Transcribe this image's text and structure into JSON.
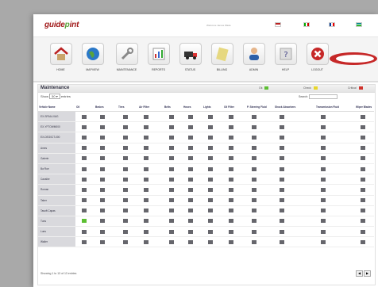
{
  "brand": {
    "logo_a": "guide",
    "logo_b": "p",
    "logo_c": "int"
  },
  "welcome_text": "Welcome James Wade",
  "nav": [
    {
      "label": "HOME",
      "icon": "house-icon"
    },
    {
      "label": "MAPVIEW",
      "icon": "globe-icon"
    },
    {
      "label": "MAINTENANCE",
      "icon": "wrench-icon"
    },
    {
      "label": "REPORTS",
      "icon": "report-chart-icon"
    },
    {
      "label": "STATUS",
      "icon": "truck-icon"
    },
    {
      "label": "BILLING",
      "icon": "billing-note-icon"
    },
    {
      "label": "ADMIN",
      "icon": "admin-person-icon"
    },
    {
      "label": "HELP",
      "icon": "help-icon"
    },
    {
      "label": "LOGOUT",
      "icon": "logout-x-icon"
    }
  ],
  "maintenance": {
    "title": "Maintenance",
    "legend_ok": "Ok",
    "legend_check": "Check",
    "legend_critical": "Critical",
    "colors": {
      "ok": "#5cbf32",
      "check": "#e8d62a",
      "critical": "#d0332d",
      "neutral": "#66666c"
    },
    "show_label": "Show",
    "show_value": "50",
    "entries_label": "entries",
    "search_label": "Search:",
    "columns": [
      "Vehicle Name",
      "Oil",
      "Brakes",
      "Tires",
      "Air Filter",
      "Belts",
      "Hoses",
      "Lights",
      "Oil Filter",
      "P. Steering Fluid",
      "Shock Absorbers",
      "Transmission Fluid",
      "Wiper Blades"
    ],
    "rows": [
      {
        "name": "EX-SF0A4-0AG",
        "oil": "neutral"
      },
      {
        "name": "EX-YFTOWM000",
        "oil": "neutral"
      },
      {
        "name": "EX-DEG0CT-000",
        "oil": "neutral"
      },
      {
        "name": "Ames",
        "oil": "neutral"
      },
      {
        "name": "Galerie",
        "oil": "neutral"
      },
      {
        "name": "Ba Rue",
        "oil": "neutral"
      },
      {
        "name": "Cavalier",
        "oil": "neutral"
      },
      {
        "name": "Roman",
        "oil": "neutral"
      },
      {
        "name": "Taber",
        "oil": "neutral"
      },
      {
        "name": "Tasoft Capas",
        "oil": "neutral"
      },
      {
        "name": "Tuns",
        "oil": "ok"
      },
      {
        "name": "Lues",
        "oil": "neutral"
      },
      {
        "name": "Waller",
        "oil": "neutral"
      }
    ],
    "footer": "Showing 1 to 13 of 13 entries"
  }
}
